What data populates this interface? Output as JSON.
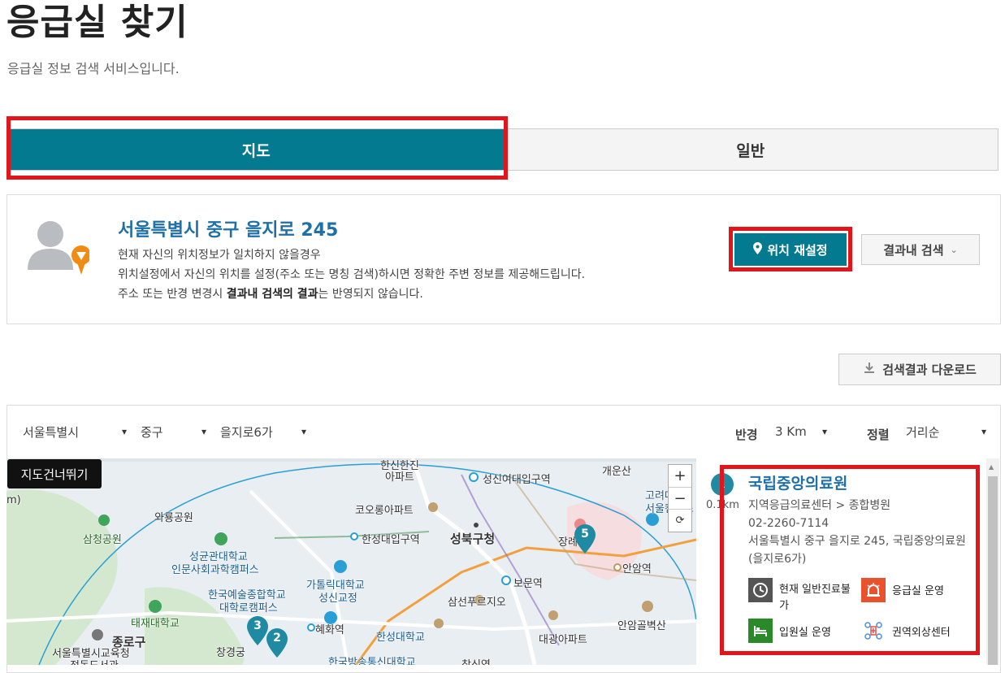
{
  "page": {
    "title": "응급실 찾기",
    "subtitle": "응급실 정보 검색 서비스입니다."
  },
  "tabs": [
    {
      "label": "지도",
      "active": true
    },
    {
      "label": "일반",
      "active": false
    }
  ],
  "location": {
    "address": "서울특별시 중구 을지로 245",
    "line1": "현재 자신의 위치정보가 일치하지 않을경우",
    "line2": "위치설정에서 자신의 위치를 설정(주소 또는 명칭 검색)하시면 정확한 주변 정보를 제공해드립니다.",
    "line3_prefix": "주소 또는 반경 변경시 ",
    "line3_bold": "결과내 검색의 결과",
    "line3_suffix": "는 반영되지 않습니다.",
    "reset_button": "위치 재설정",
    "insearch_button": "결과내 검색"
  },
  "download_button": "검색결과 다운로드",
  "filters": {
    "city": "서울특별시",
    "district": "중구",
    "street": "을지로6가",
    "radius_label": "반경",
    "radius_value": "3 Km",
    "sort_label": "정렬",
    "sort_value": "거리순"
  },
  "map": {
    "skip_link": "지도건너뛰기",
    "zoom_in": "+",
    "zoom_out": "−",
    "reset": "⟳",
    "labels": [
      "한신한진",
      "아파트",
      "성신여대입구역",
      "개운산",
      "고려대학",
      "서울캠퍼스",
      "와룡공원",
      "코오롱아파트",
      "삼청공원",
      "한성대입구역",
      "성북구청",
      "장례",
      "안암역",
      "성균관대학교",
      "인문사회과학캠퍼스",
      "가톨릭대학교",
      "성신교정",
      "보문역",
      "한국예술종합학교",
      "대학로캠퍼스",
      "삼선푸르지오",
      "태재대학교",
      "혜화역",
      "한성대학교",
      "대광아파트",
      "안암골벽산",
      "종로구",
      "창경궁",
      "서울특별시교육청",
      "정독도서관",
      "한국방송통신대학교",
      "창신역",
      "m)"
    ],
    "markers": [
      "3",
      "2",
      "5"
    ]
  },
  "results": [
    {
      "index": "1",
      "distance": "0.1km",
      "name": "국립중앙의료원",
      "category": "지역응급의료센터 > 종합병원",
      "phone": "02-2260-7114",
      "address": "서울특별시 중구 을지로 245, 국립중앙의료원 (을지로6가)",
      "features": [
        {
          "icon": "clock-icon",
          "label": "현재 일반진료불가",
          "color": "#555555"
        },
        {
          "icon": "siren-icon",
          "label": "응급실 운영",
          "color": "#e8522c"
        },
        {
          "icon": "bed-icon",
          "label": "입원실 운영",
          "color": "#2a8a2a"
        },
        {
          "icon": "trauma-center-icon",
          "label": "권역외상센터",
          "color": "#4a90d9"
        }
      ]
    }
  ],
  "colors": {
    "accent": "#047a91",
    "link": "#1f6fa8",
    "highlight": "#e0161b"
  }
}
